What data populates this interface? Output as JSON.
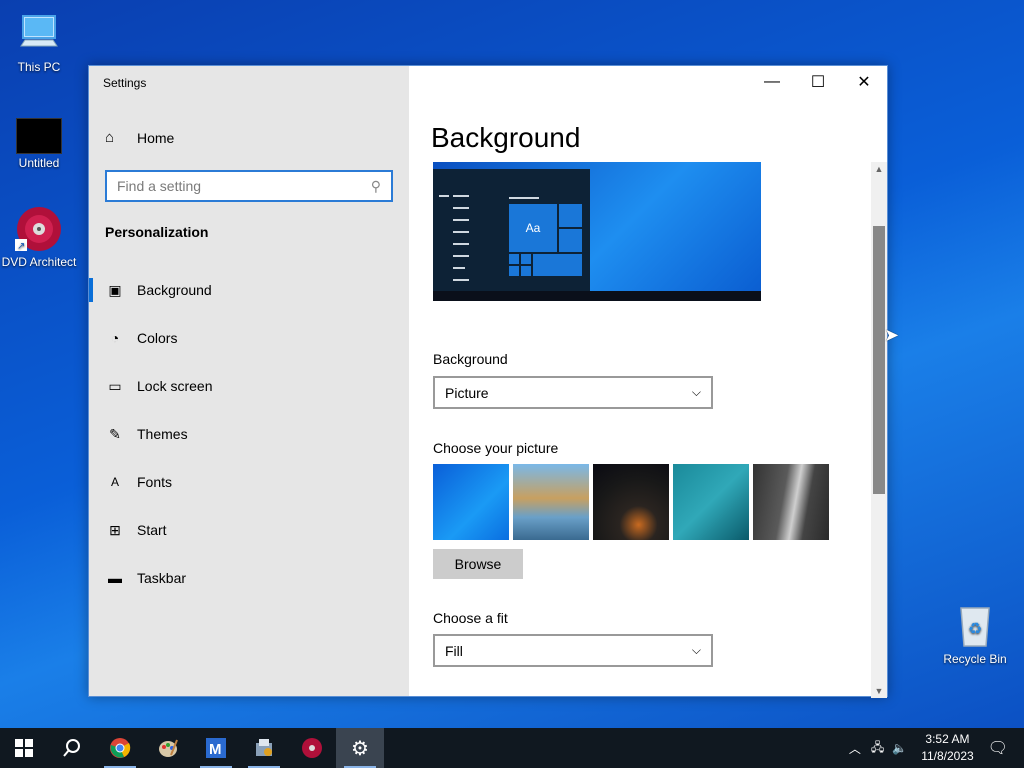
{
  "desktop": {
    "icons": [
      {
        "label": "This PC",
        "icon": "computer-icon"
      },
      {
        "label": "Untitled",
        "icon": "blank-document-icon"
      },
      {
        "label": "DVD Architect",
        "icon": "dvd-icon"
      },
      {
        "label": "Recycle Bin",
        "icon": "recycle-bin-icon"
      }
    ]
  },
  "window": {
    "title": "Settings",
    "controls": {
      "minimize": "—",
      "maximize": "☐",
      "close": "✕"
    }
  },
  "sidebar": {
    "home_label": "Home",
    "search_placeholder": "Find a setting",
    "section_title": "Personalization",
    "items": [
      {
        "label": "Background",
        "icon": "picture-icon",
        "active": true
      },
      {
        "label": "Colors",
        "icon": "palette-icon",
        "active": false
      },
      {
        "label": "Lock screen",
        "icon": "lock-screen-icon",
        "active": false
      },
      {
        "label": "Themes",
        "icon": "brush-icon",
        "active": false
      },
      {
        "label": "Fonts",
        "icon": "font-icon",
        "active": false
      },
      {
        "label": "Start",
        "icon": "start-icon",
        "active": false
      },
      {
        "label": "Taskbar",
        "icon": "taskbar-icon",
        "active": false
      }
    ]
  },
  "main": {
    "page_title": "Background",
    "preview_tile_text": "Aa",
    "background_label": "Background",
    "background_value": "Picture",
    "choose_picture_label": "Choose your picture",
    "browse_label": "Browse",
    "fit_label": "Choose a fit",
    "fit_value": "Fill"
  },
  "taskbar": {
    "apps": [
      "start-icon",
      "search-icon",
      "chrome-icon",
      "paint-icon",
      "visual-studio-icon",
      "installer-icon",
      "dvd-icon",
      "settings-icon"
    ],
    "time": "3:52 AM",
    "date": "11/8/2023"
  },
  "colors": {
    "accent": "#0a6fd8",
    "sidebar_bg": "#e6e6e6",
    "taskbar_bg": "#101820"
  }
}
